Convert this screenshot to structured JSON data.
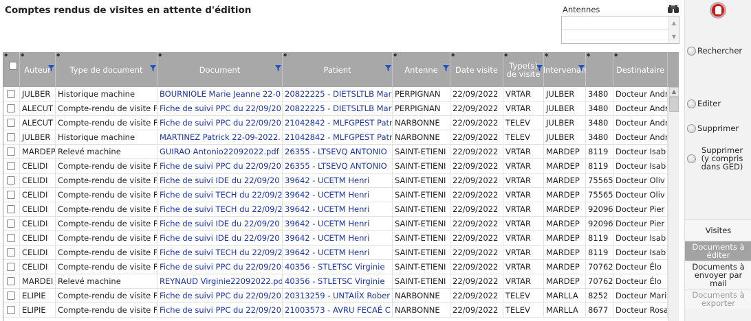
{
  "title": "Comptes rendus de visites en attente d'édition",
  "antennes": {
    "label": "Antennes",
    "items": [
      "",
      ""
    ]
  },
  "columns": [
    {
      "key": "auteur",
      "label": "Auteur"
    },
    {
      "key": "type",
      "label": "Type de document"
    },
    {
      "key": "document",
      "label": "Document"
    },
    {
      "key": "patient",
      "label": "Patient"
    },
    {
      "key": "antenne",
      "label": "Antenne"
    },
    {
      "key": "date",
      "label": "Date visite"
    },
    {
      "key": "typev",
      "label": "Type(s) de visite"
    },
    {
      "key": "intervenant",
      "label": "Intervenan"
    },
    {
      "key": "code",
      "label": ""
    },
    {
      "key": "destinataire",
      "label": "Destinataire"
    }
  ],
  "rows": [
    [
      "JULBER",
      "Historique machine",
      "BOURNIOLE Marie Jeanne 22-0",
      "20822225 - DIETSLTLB Mar",
      "PERPIGNAN",
      "22/09/2022",
      "VRTAR",
      "JULBER",
      "3480",
      "Docteur Andr"
    ],
    [
      "ALECUT",
      "Compte-rendu de visite F",
      "Fiche de suivi PPC du 22/09/20",
      "20822225 - DIETSLTLB Mar",
      "PERPIGNAN",
      "22/09/2022",
      "VRTAR",
      "JULBER",
      "3480",
      "Docteur Andr"
    ],
    [
      "ALECUT",
      "Compte-rendu de visite F",
      "Fiche de suivi PPC du 22/09/20",
      "21042842 - MLFGPEST Patr",
      "NARBONNE",
      "22/09/2022",
      "TELEV",
      "JULBER",
      "3480",
      "Docteur Andr"
    ],
    [
      "JULBER",
      "Historique machine",
      "MARTINEZ Patrick 22-09-2022.",
      "21042842 - MLFGPEST Patr",
      "NARBONNE",
      "22/09/2022",
      "TELEV",
      "JULBER",
      "3480",
      "Docteur Andr"
    ],
    [
      "MARDEP",
      "Relevé machine",
      "GUIRAO Antonio22092022.pdf",
      "26355 - LTSEVQ ANTONIO",
      "SAINT-ETIENI",
      "22/09/2022",
      "VRTAR",
      "MARDEP",
      "8119",
      "Docteur Isab"
    ],
    [
      "CELIDI",
      "Compte-rendu de visite F",
      "Fiche de suivi PPC du 22/09/20",
      "26355 - LTSEVQ ANTONIO",
      "SAINT-ETIENI",
      "22/09/2022",
      "VRTAR",
      "MARDEP",
      "8119",
      "Docteur Isab"
    ],
    [
      "CELIDI",
      "Compte-rendu de visite F",
      "Fiche de suivi IDE du 22/09/20",
      "39642 - UCETM Henri",
      "SAINT-ETIENI",
      "22/09/2022",
      "VRTAR",
      "MARDEP",
      "75565",
      "Docteur Oliv"
    ],
    [
      "CELIDI",
      "Compte-rendu de visite F",
      "Fiche de suivi TECH du 22/09/2",
      "39642 - UCETM Henri",
      "SAINT-ETIENI",
      "22/09/2022",
      "VRTAR",
      "MARDEP",
      "75565",
      "Docteur Oliv"
    ],
    [
      "CELIDI",
      "Compte-rendu de visite F",
      "Fiche de suivi TECH du 22/09/2",
      "39642 - UCETM Henri",
      "SAINT-ETIENI",
      "22/09/2022",
      "VRTAR",
      "MARDEP",
      "92096",
      "Docteur Pier"
    ],
    [
      "CELIDI",
      "Compte-rendu de visite F",
      "Fiche de suivi IDE du 22/09/20",
      "39642 - UCETM Henri",
      "SAINT-ETIENI",
      "22/09/2022",
      "VRTAR",
      "MARDEP",
      "92096",
      "Docteur Pier"
    ],
    [
      "CELIDI",
      "Compte-rendu de visite F",
      "Fiche de suivi IDE du 22/09/20",
      "39642 - UCETM Henri",
      "SAINT-ETIENI",
      "22/09/2022",
      "VRTAR",
      "MARDEP",
      "8119",
      "Docteur Isab"
    ],
    [
      "CELIDI",
      "Compte-rendu de visite F",
      "Fiche de suivi TECH du 22/09/2",
      "39642 - UCETM Henri",
      "SAINT-ETIENI",
      "22/09/2022",
      "VRTAR",
      "MARDEP",
      "8119",
      "Docteur Isab"
    ],
    [
      "CELIDI",
      "Compte-rendu de visite F",
      "Fiche de suivi PPC du 22/09/20",
      "40356 - STLETSC Virginie",
      "SAINT-ETIENI",
      "22/09/2022",
      "VRTAR",
      "MARDEP",
      "70762",
      "Docteur Élo"
    ],
    [
      "MARDEI",
      "Relevé machine",
      "REYNAUD Virginie22092022.pd",
      "40356 - STLETSC Virginie",
      "SAINT-ETIENI",
      "22/09/2022",
      "VRTAR",
      "MARDEP",
      "70762",
      "Docteur Élo"
    ],
    [
      "ELIPIE",
      "Compte-rendu de visite F",
      "Fiche de suivi PPC du 22/09/20",
      "20313259 - UNTAIÎX Rober",
      "NARBONNE",
      "22/09/2022",
      "TELEV",
      "MARLLA",
      "8252",
      "Docteur Marie"
    ],
    [
      "ELIPIE",
      "Compte-rendu de visite F",
      "Fiche de suivi PPC du 22/09/20",
      "21003573 - AVRU FECAÉ C",
      "NARBONNE",
      "22/09/2022",
      "TELEV",
      "MARLLA",
      "8677",
      "Docteur Rosa"
    ]
  ],
  "actions": {
    "rechercher": "Rechercher",
    "editer": "Editer",
    "supprimer": "Supprimer",
    "supprimer_ged": "Supprimer (y compris dans GED)"
  },
  "nav": {
    "visites": "Visites",
    "docs_editer": "Documents à éditer",
    "docs_envoyer": "Documents à envoyer par mail",
    "docs_exporter": "Documents à exporter"
  },
  "colors": {
    "header_bg": "#a8a8a8",
    "link": "#1a35a8",
    "stop": "#c21b1b",
    "active_nav": "#a3a3a3"
  }
}
